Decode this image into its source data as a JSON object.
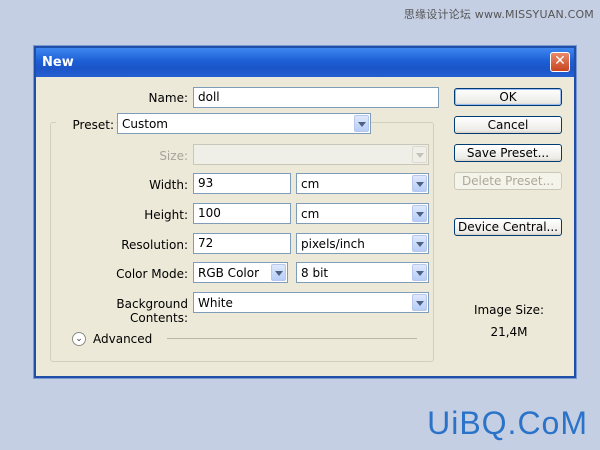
{
  "watermark": {
    "top": "思缘设计论坛 www.MISSYUAN.COM",
    "bottom": "UiBQ.CoM"
  },
  "dialog": {
    "title": "New",
    "close_symbol": "✕",
    "name": {
      "label": "Name:",
      "value": "doll"
    },
    "preset": {
      "label": "Preset:",
      "value": "Custom"
    },
    "size": {
      "label": "Size:",
      "value": ""
    },
    "width": {
      "label": "Width:",
      "value": "93",
      "unit": "cm"
    },
    "height": {
      "label": "Height:",
      "value": "100",
      "unit": "cm"
    },
    "resolution": {
      "label": "Resolution:",
      "value": "72",
      "unit": "pixels/inch"
    },
    "color_mode": {
      "label": "Color Mode:",
      "value": "RGB Color",
      "depth": "8 bit"
    },
    "background": {
      "label": "Background Contents:",
      "value": "White"
    },
    "advanced": {
      "label": "Advanced",
      "icon": "⌄"
    },
    "buttons": {
      "ok": "OK",
      "cancel": "Cancel",
      "save_preset": "Save Preset...",
      "delete_preset": "Delete Preset...",
      "device_central": "Device Central..."
    },
    "image_size": {
      "label": "Image Size:",
      "value": "21,4M"
    }
  }
}
